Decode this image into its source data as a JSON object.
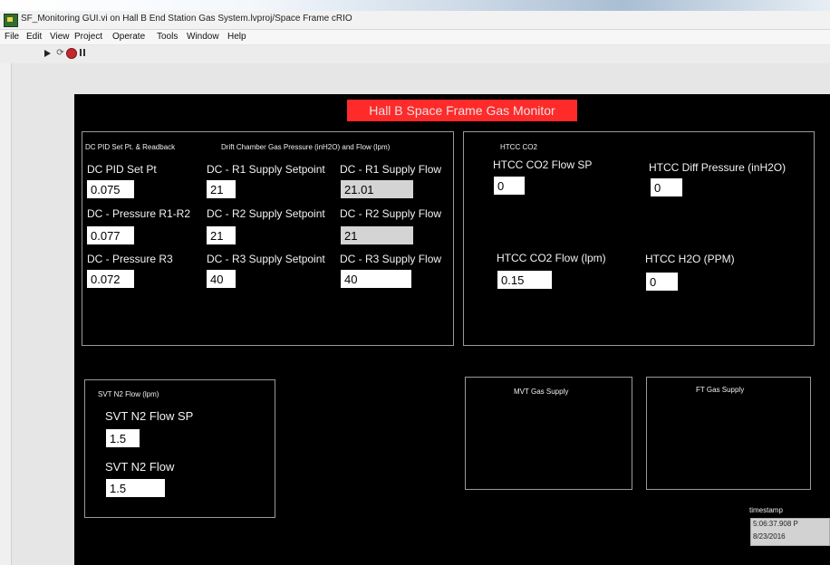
{
  "window": {
    "title": "SF_Monitoring GUI.vi on Hall B End Station Gas System.lvproj/Space Frame cRIO"
  },
  "menu": [
    "File",
    "Edit",
    "View",
    "Project",
    "Operate",
    "Tools",
    "Window",
    "Help"
  ],
  "panel": {
    "title": "Hall B Space Frame Gas Monitor",
    "title_color": "#ff2a2a"
  },
  "dc": {
    "group_label": "DC PID Set Pt. & Readback",
    "chamber_label": "Drift Chamber Gas Pressure (inH2O) and Flow (lpm)",
    "pid_set_pt_label": "DC PID Set Pt",
    "pid_set_pt_value": "0.075",
    "pressure_r1r2_label": "DC - Pressure R1-R2",
    "pressure_r1r2_value": "0.077",
    "pressure_r3_label": "DC - Pressure R3",
    "pressure_r3_value": "0.072",
    "r1_setpoint_label": "DC - R1 Supply Setpoint",
    "r1_setpoint_value": "21",
    "r2_setpoint_label": "DC - R2 Supply Setpoint",
    "r2_setpoint_value": "21",
    "r3_setpoint_label": "DC - R3 Supply Setpoint",
    "r3_setpoint_value": "40",
    "r1_flow_label": "DC - R1 Supply Flow",
    "r1_flow_value": "21.01",
    "r2_flow_label": "DC - R2 Supply Flow",
    "r2_flow_value": "21",
    "r3_flow_label": "DC - R3 Supply Flow",
    "r3_flow_value": "40"
  },
  "htcc": {
    "group_label": "HTCC CO2",
    "co2_flow_sp_label": "HTCC CO2 Flow SP",
    "co2_flow_sp_value": "0",
    "diff_pressure_label": "HTCC Diff Pressure (inH2O)",
    "diff_pressure_value": "0",
    "co2_flow_label": "HTCC CO2 Flow (lpm)",
    "co2_flow_value": "0.15",
    "h2o_label": "HTCC H2O (PPM)",
    "h2o_value": "0"
  },
  "svt": {
    "group_label": "SVT N2 Flow (lpm)",
    "flow_sp_label": "SVT N2 Flow SP",
    "flow_sp_value": "1.5",
    "flow_label": "SVT N2 Flow",
    "flow_value": "1.5"
  },
  "mvt": {
    "label": "MVT Gas Supply"
  },
  "ft": {
    "label": "FT Gas Supply"
  },
  "timestamp": {
    "label": "timestamp",
    "time": "5:06:37.908 P",
    "date": "8/23/2016"
  },
  "toolbar_icons": [
    "run-icon",
    "run-continuously-icon",
    "abort-icon",
    "pause-icon"
  ]
}
